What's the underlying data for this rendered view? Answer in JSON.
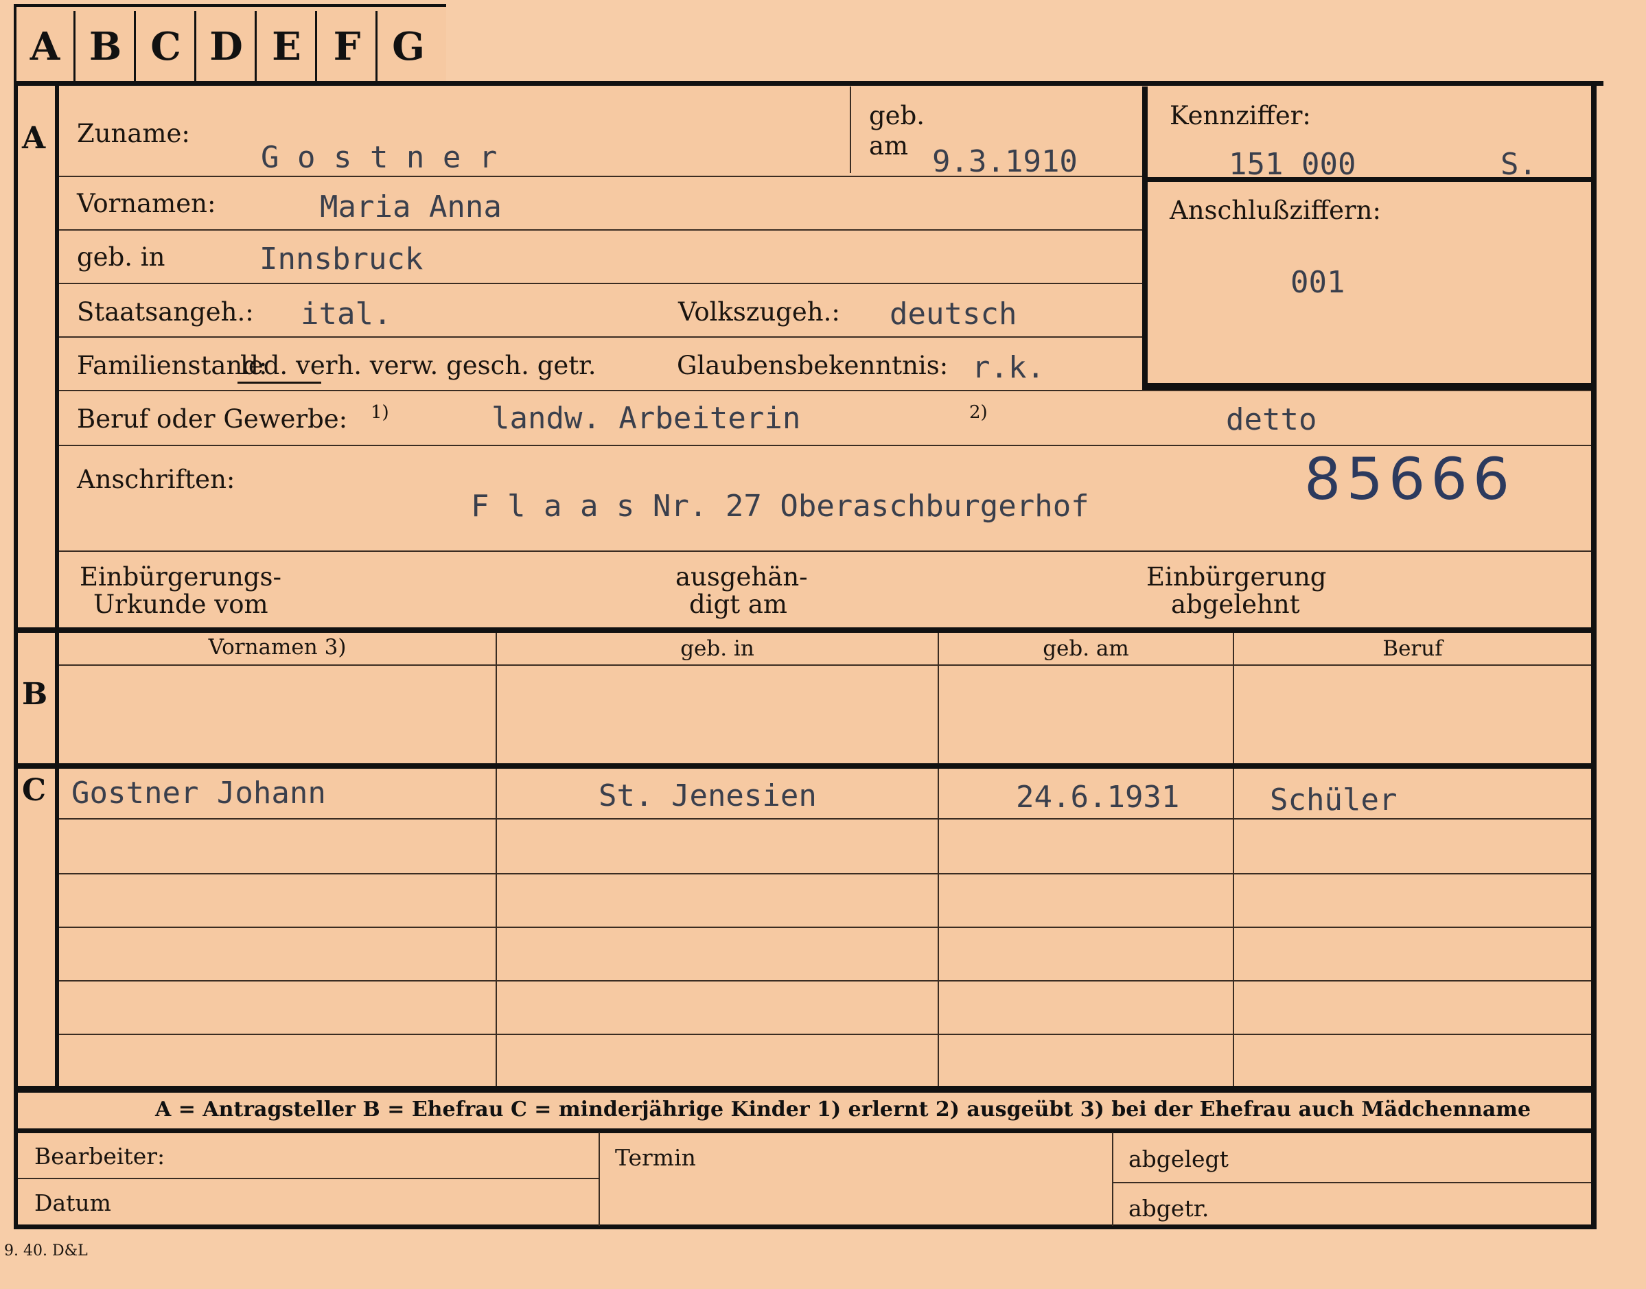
{
  "tabs": [
    "A",
    "B",
    "C",
    "D",
    "E",
    "F",
    "G"
  ],
  "sections": {
    "a": "A",
    "b": "B",
    "c": "C"
  },
  "labels": {
    "zuname": "Zuname:",
    "geb": "geb.",
    "am": "am",
    "kennziffer": "Kennziffer:",
    "vornamen": "Vornamen:",
    "anschlussziffern": "Anschlußziffern:",
    "geb_in": "geb. in",
    "staatsangeh": "Staatsangeh.:",
    "volkszugeh": "Volkszugeh.:",
    "familienstand": "Familienstand:",
    "familienstand_options": "led. verh. verw. gesch. getr.",
    "glaubensbekenntnis": "Glaubensbekenntnis:",
    "beruf": "Beruf oder Gewerbe:",
    "beruf_note1": "1)",
    "beruf_note2": "2)",
    "anschriften": "Anschriften:",
    "einbuergerungs_1": "Einbürgerungs-",
    "einbuergerungs_2": "Urkunde vom",
    "ausgehaen_1": "ausgehän-",
    "ausgehaen_2": "digt am",
    "einbuergerung_1": "Einbürgerung",
    "einbuergerung_2": "abgelehnt",
    "bearbeiter": "Bearbeiter:",
    "datum": "Datum",
    "termin": "Termin",
    "abgelegt": "abgelegt",
    "abgetr": "abgetr."
  },
  "values": {
    "zuname": "G o s t n e r",
    "geb_am": "9.3.1910",
    "kennziffer": "151 000",
    "kennziffer_suffix": "S.",
    "vornamen": "Maria Anna",
    "anschlussziffern": "001",
    "geb_in": "Innsbruck",
    "staatsangeh": "ital.",
    "volkszugeh": "deutsch",
    "glaubensbekenntnis": "r.k.",
    "beruf_erlernt": "landw. Arbeiterin",
    "beruf_ausgeuebt": "detto",
    "anschrift": "F l a a s  Nr. 27  Oberaschburgerhof",
    "stamp_number": "85666"
  },
  "table_b": {
    "headers": [
      "Vornamen 3)",
      "geb. in",
      "geb. am",
      "Beruf"
    ]
  },
  "table_c": {
    "rows": [
      [
        "Gostner Johann",
        "St. Jenesien",
        "24.6.1931",
        "Schüler"
      ]
    ]
  },
  "legend": "A = Antragsteller   B = Ehefrau   C = minderjährige Kinder   1) erlernt   2) ausgeübt   3) bei der Ehefrau auch Mädchenname",
  "footer_code": "9. 40. D&L"
}
